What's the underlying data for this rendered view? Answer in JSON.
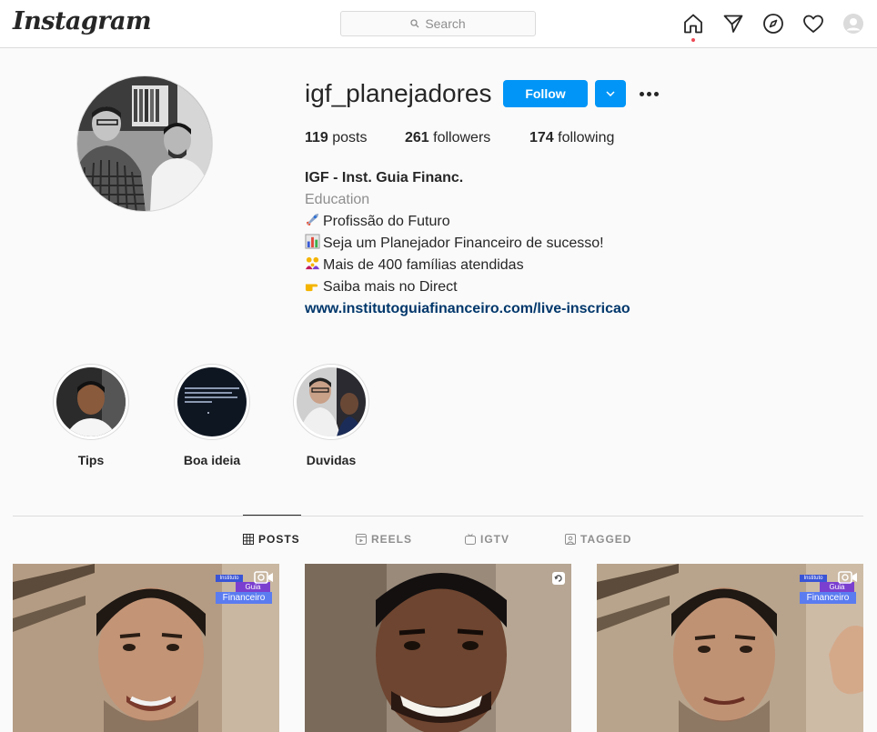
{
  "nav": {
    "logo": "Instagram",
    "search_placeholder": "Search"
  },
  "profile": {
    "username": "igf_planejadores",
    "follow_label": "Follow",
    "stats": {
      "posts_count": "119",
      "posts_label": " posts",
      "followers_count": "261",
      "followers_label": " followers",
      "following_count": "174",
      "following_label": " following"
    },
    "bio": {
      "name": "IGF - Inst. Guia Financ.",
      "category": "Education",
      "lines": [
        "Profissão do Futuro",
        "Seja um Planejador Financeiro de sucesso!",
        "Mais de 400 famílias atendidas",
        "Saiba mais no Direct"
      ],
      "link": "www.institutoguiafinanceiro.com/live-inscricao"
    }
  },
  "highlights": [
    {
      "label": "Tips"
    },
    {
      "label": "Boa ideia"
    },
    {
      "label": "Duvidas"
    }
  ],
  "tabs": [
    {
      "label": "POSTS",
      "active": true
    },
    {
      "label": "REELS",
      "active": false
    },
    {
      "label": "IGTV",
      "active": false
    },
    {
      "label": "TAGGED",
      "active": false
    }
  ],
  "watermark": {
    "line1": "Instituto",
    "line2": "Guia",
    "line3": "Financeiro"
  },
  "colors": {
    "accent": "#0095f6",
    "link": "#00376b",
    "notification_dot": "#ed4956"
  }
}
